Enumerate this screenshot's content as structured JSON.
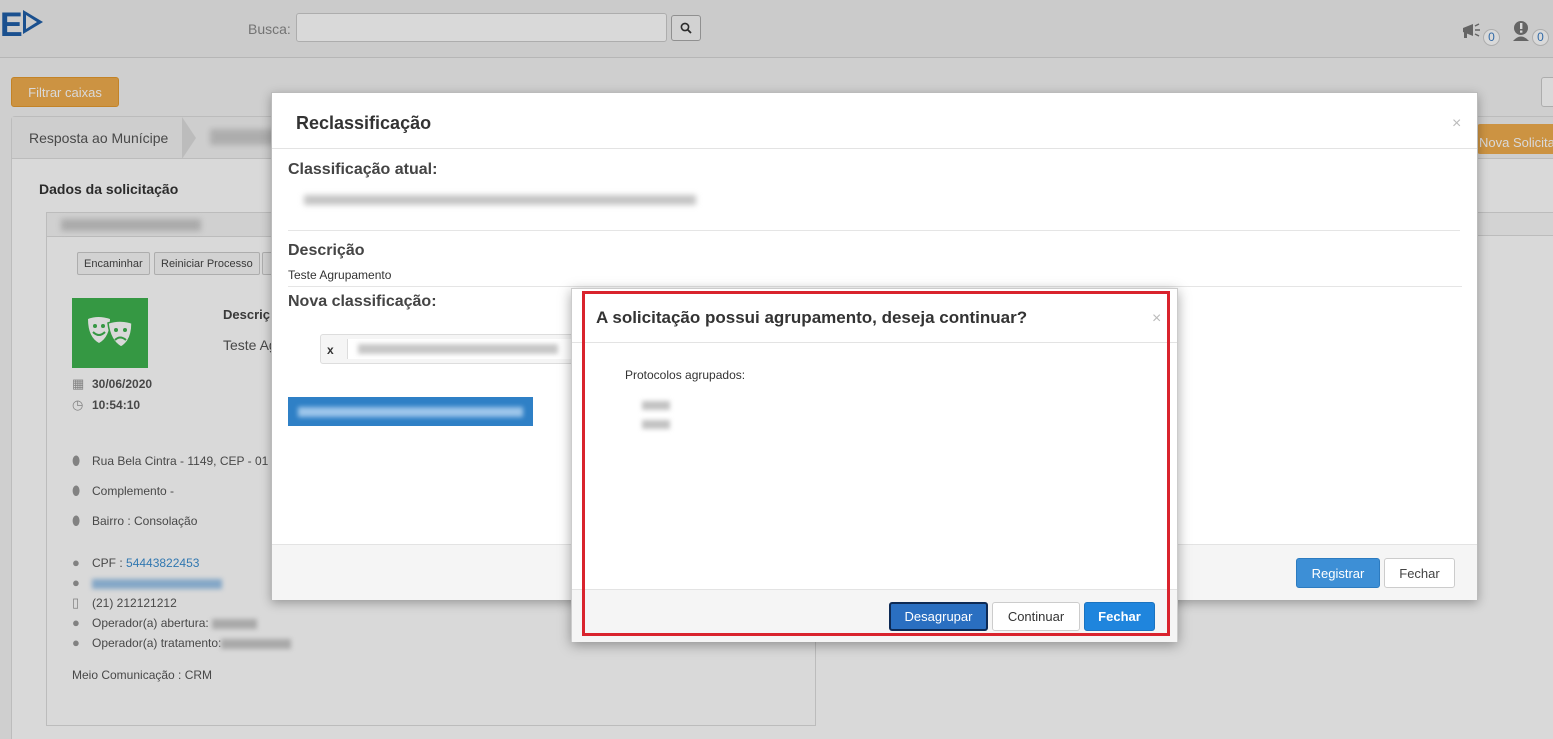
{
  "header": {
    "logo_text": "E",
    "search_label": "Busca:",
    "search_value": "",
    "notifications": [
      {
        "icon": "megaphone-icon",
        "count": "0"
      },
      {
        "icon": "alert-user-icon",
        "count": "0"
      }
    ]
  },
  "page": {
    "filter_button": "Filtrar caixas",
    "breadcrumb": [
      "Resposta ao Munícipe"
    ],
    "nova_button": "Nova Solicita",
    "section_title": "Dados da solicitação",
    "actions": [
      "Encaminhar",
      "Reiniciar Processo"
    ],
    "description_label": "Descriç",
    "description_value": "Teste Ag",
    "date": "30/06/2020",
    "time": "10:54:10",
    "address": "Rua Bela Cintra - 1149, CEP - 01",
    "complement": "Complemento -",
    "district": "Bairro : Consolação",
    "cpf_label": "CPF :",
    "cpf_value": "54443822453",
    "phone": "(21) 212121212",
    "operator_open_label": "Operador(a) abertura:",
    "operator_treat_label": "Operador(a) tratamento:",
    "channel": "Meio Comunicação : CRM"
  },
  "reclass_modal": {
    "title": "Reclassificação",
    "close": "×",
    "current_label": "Classificação atual:",
    "description_label": "Descrição",
    "description_value": "Teste Agrupamento",
    "new_label": "Nova classificação:",
    "tag_remove": "x",
    "register_button": "Registrar",
    "close_button": "Fechar"
  },
  "confirm_modal": {
    "title": "A solicitação possui agrupamento, deseja continuar?",
    "close": "×",
    "protocols_label": "Protocolos agrupados:",
    "ungroup_button": "Desagrupar",
    "continue_button": "Continuar",
    "close_button": "Fechar"
  },
  "colors": {
    "accent_orange": "#f0ad4e",
    "primary_blue": "#1f85dd",
    "highlight_red": "#d9232d",
    "avatar_green": "#3fb34f"
  }
}
